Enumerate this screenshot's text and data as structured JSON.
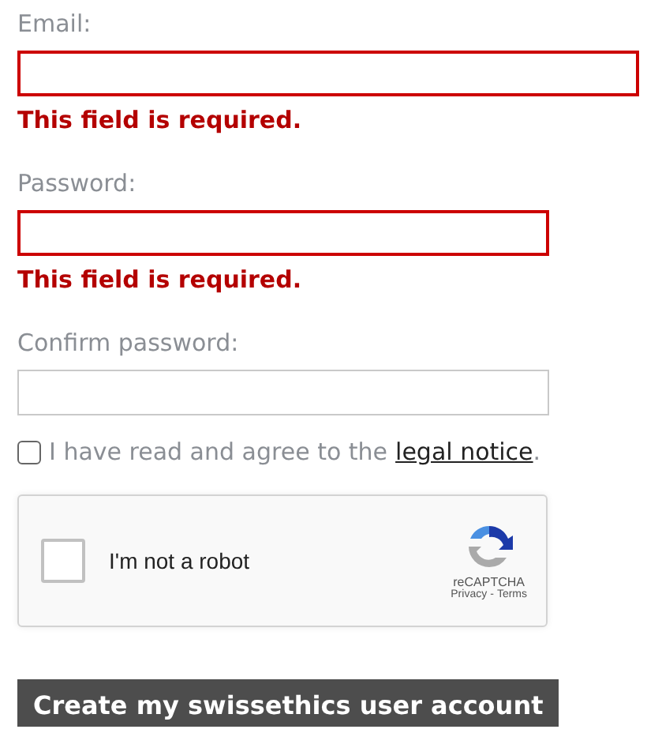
{
  "fields": [
    {
      "label": "Email:",
      "kind": "email",
      "invalid": true,
      "error": "This field is required."
    },
    {
      "label": "Password:",
      "kind": "password",
      "invalid": true,
      "error": "This field is required."
    },
    {
      "label": "Confirm password:",
      "kind": "password",
      "invalid": false
    }
  ],
  "agreement": {
    "checked": false,
    "text": "I have read and agree to the",
    "link": "legal notice",
    "end": "."
  },
  "captcha": {
    "checked": false,
    "label": "I'm not a robot",
    "brand": "reCAPTCHA",
    "privacy": "Privacy",
    "separator": "-",
    "terms": "Terms"
  },
  "submit": "Create my swissethics user account"
}
